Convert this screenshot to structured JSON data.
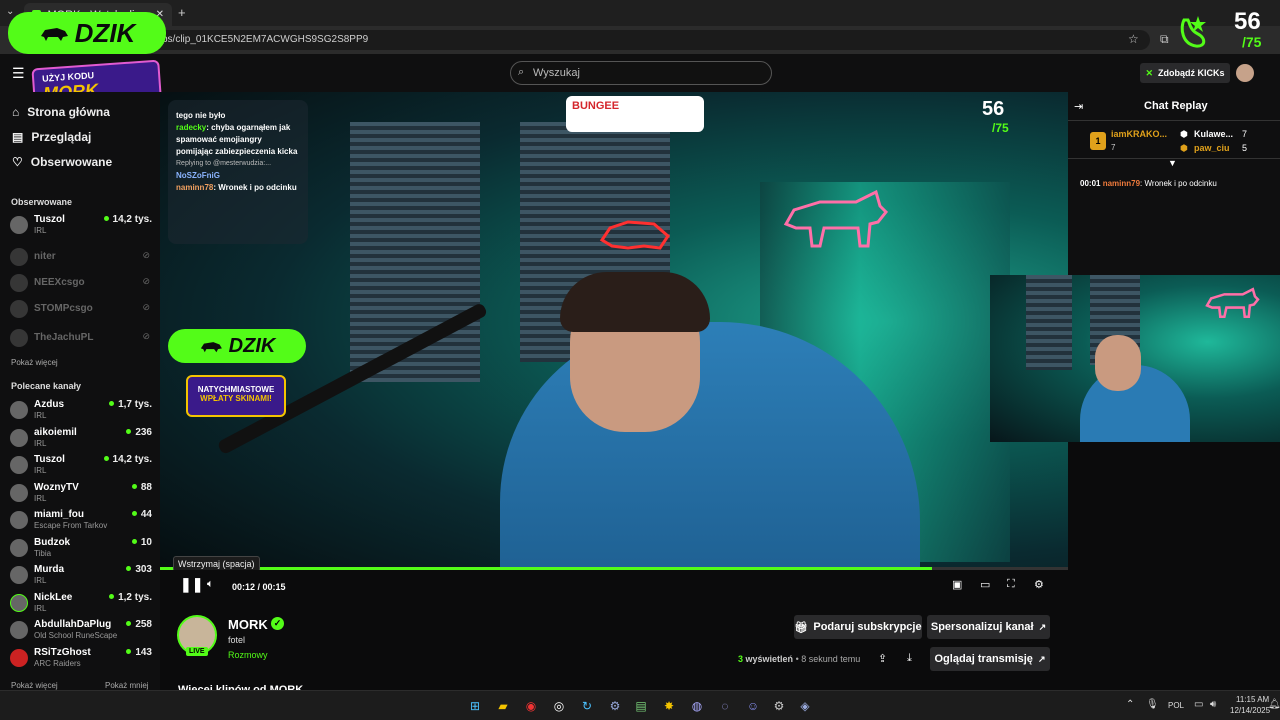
{
  "browser": {
    "tab_title": "MORK - Watch clips on Kick",
    "url_suffix": "ps/clip_01KCE5N2EM7ACWGHS9SG2S8PP9"
  },
  "overlays": {
    "dzik_label": "DZIK",
    "promo_line1": "UŻYJ KODU",
    "promo_line2": "MORK",
    "counter_value": "56",
    "counter_total": "/75"
  },
  "header": {
    "search_placeholder": "Wyszukaj",
    "kicks_button": "Zdobądź KICKs"
  },
  "sidebar": {
    "nav": [
      {
        "label": "Strona główna",
        "icon": "home-icon"
      },
      {
        "label": "Przeglądaj",
        "icon": "browse-icon"
      },
      {
        "label": "Obserwowane",
        "icon": "heart-icon"
      }
    ],
    "followed_header": "Obserwowane",
    "followed": [
      {
        "name": "Tuszol",
        "category": "IRL",
        "viewers": "14,2 tys.",
        "live": true
      },
      {
        "name": "niter",
        "live": false
      },
      {
        "name": "NEEXcsgo",
        "live": false
      },
      {
        "name": "STOMPcsgo",
        "live": false
      },
      {
        "name": "TheJachuPL",
        "live": false
      }
    ],
    "show_more": "Pokaż więcej",
    "recommended_header": "Polecane kanały",
    "recommended": [
      {
        "name": "Azdus",
        "category": "IRL",
        "viewers": "1,7 tys."
      },
      {
        "name": "aikoiemil",
        "category": "IRL",
        "viewers": "236"
      },
      {
        "name": "Tuszol",
        "category": "IRL",
        "viewers": "14,2 tys."
      },
      {
        "name": "WoznyTV",
        "category": "IRL",
        "viewers": "88"
      },
      {
        "name": "miami_fou",
        "category": "Escape From Tarkov",
        "viewers": "44"
      },
      {
        "name": "Budzok",
        "category": "Tibia",
        "viewers": "10"
      },
      {
        "name": "Murda",
        "category": "IRL",
        "viewers": "303"
      },
      {
        "name": "NickLee",
        "category": "IRL",
        "viewers": "1,2 tys."
      },
      {
        "name": "AbdullahDaPlug",
        "category": "Old School RuneScape",
        "viewers": "258"
      },
      {
        "name": "RSiTzGhost",
        "category": "ARC Raiders",
        "viewers": "143"
      }
    ],
    "show_more_2": "Pokaż więcej",
    "show_less": "Pokaż mniej"
  },
  "video": {
    "overlay_chat": {
      "line1": "tego nie było",
      "user1": "radecky",
      "msg1": ": chyba ogarnąłem jak spamować emojiangry pomijając zabiezpieczenia kicka",
      "reply": "Replying to @mesterwudzia:...",
      "user2": "NoSZoFniG",
      "user3": "naminn78",
      "msg3": ": Wronek i po odcinku"
    },
    "sponsor": "BUNGEE",
    "promo_line1": "NATYCHMIASTOWE",
    "promo_line2": "WPŁATY SKINAMI!",
    "progress": 0.85,
    "tooltip": "Wstrzymaj (spacja)",
    "time": "00:12 / 00:15"
  },
  "channel": {
    "name": "MORK",
    "title": "fotel",
    "category": "Rozmowy",
    "live_badge": "LIVE",
    "gift_button": "Podaruj subskrypcje",
    "personalize_button": "Spersonalizuj kanał",
    "views_count": "3",
    "views_label": "wyświetleń",
    "time_ago": "• 8 sekund temu",
    "watch_button": "Oglądaj transmisję",
    "more_clips": "Więcej klipów od MORK"
  },
  "chat": {
    "title": "Chat Replay",
    "leaders": [
      {
        "rank": "1",
        "name": "iamKRAKO...",
        "count": "7"
      },
      {
        "name": "Kulawe...",
        "count": "7"
      },
      {
        "name": "paw_ciu",
        "count": "5"
      }
    ],
    "message": {
      "time": "00:01",
      "user": "naminn79",
      "text": ": Wronek i po odcinku"
    }
  },
  "taskbar": {
    "lang": "POL",
    "time": "11:15 AM",
    "date": "12/14/2025"
  },
  "colors": {
    "accent": "#53fc18",
    "background": "#0b0b0c",
    "panel": "#0f0f10"
  }
}
